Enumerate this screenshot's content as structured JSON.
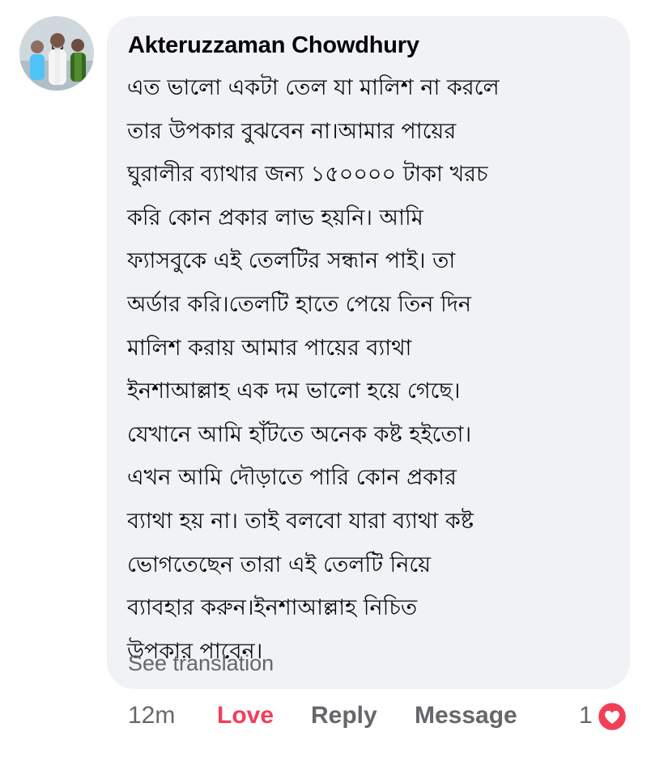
{
  "comment": {
    "author": "Akteruzzaman Chowdhury",
    "avatar_icon": "profile-photo-three-people",
    "text": "এত ভালো একটা তেল যা মালিশ না করলে\nতার উপকার বুঝবেন না।আমার পায়ের\nঘুরালীর ব্যাথার জন্য ১৫০০০০ টাকা খরচ\nকরি কোন প্রকার লাভ হয়নি। আমি\nফ্যাসবুকে এই তেলটির সন্ধান পাই। তা\nঅর্ডার করি।তেলটি হাতে পেয়ে তিন দিন\nমালিশ করায় আমার পায়ের ব্যাথা\nইনশাআল্লাহ এক দম ভালো হয়ে গেছে।\nযেখানে আমি হাঁটতে অনেক কষ্ট হইতো।\nএখন আমি দৌড়াতে পারি কোন প্রকার\nব্যাথা হয় না। তাই বলবো যারা ব্যাথা কষ্ট\nভোগতেছেন তারা এই তেলটি নিয়ে\nব্যাবহার করুন।ইনশাআল্লাহ নিচিত\nউপকার পাবেন।",
    "see_translation": "See translation"
  },
  "actions": {
    "time": "12m",
    "love": "Love",
    "reply": "Reply",
    "message": "Message",
    "reaction_count": "1",
    "reaction_icon": "heart-icon"
  },
  "colors": {
    "bubble_bg": "#f0f2f5",
    "text": "#050505",
    "secondary": "#65676b",
    "love_red": "#f33e58"
  }
}
